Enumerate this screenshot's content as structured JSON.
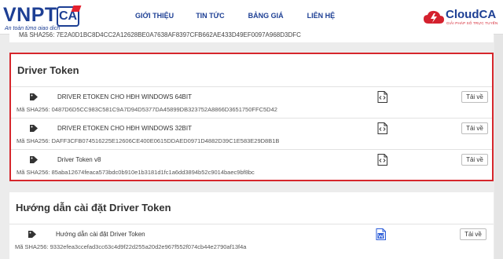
{
  "brand": {
    "logo_text": "VNPT",
    "logo_ca": "CA",
    "logo_tagline": "An toàn từng giao dịch",
    "cloud_name": "CloudCA",
    "cloud_tagline": "GIẢI PHÁP SỐ TRỰC TUYẾN"
  },
  "nav": {
    "items": [
      "GIỚI THIỆU",
      "TIN TỨC",
      "BẢNG GIÁ",
      "LIÊN HỆ"
    ]
  },
  "top_card": {
    "sha_label": "Mã SHA256:",
    "sha_value": "7E2A0D1BC8D4CC2A12628BE0A7638AF8397CFB662AE433D49EF0097A968D3DFC"
  },
  "sections": [
    {
      "title": "Driver Token",
      "items": [
        {
          "name": "DRIVER ETOKEN CHO HĐH WINDOWS 64BIT",
          "sha_label": "Mã SHA256:",
          "sha_value": "0487D6D5CC983C581C9A7D94D5377DA45899DB323752A8866D3651750FFC5D42",
          "file_type": "code",
          "download_label": "Tải về"
        },
        {
          "name": "DRIVER ETOKEN CHO HĐH WINDOWS 32BIT",
          "sha_label": "Mã SHA256:",
          "sha_value": "DAFF3CFB074516225E12606CE400E0615DDAED0971D4882D39C1E583E29D8B1B",
          "file_type": "code",
          "download_label": "Tải về"
        },
        {
          "name": "Driver Token v8",
          "sha_label": "Mã SHA256:",
          "sha_value": "85aba12674feaca573bdc0b910e1b3181d1fc1a6dd3894b52c9014baec9bf8bc",
          "file_type": "code",
          "download_label": "Tải về"
        }
      ]
    },
    {
      "title": "Hướng dẫn cài đặt Driver Token",
      "items": [
        {
          "name": "Hướng dẫn cài đặt Driver Token",
          "sha_label": "Mã SHA256:",
          "sha_value": "9332efea3ccefad3cc63c4d9f22d255a20d2e967f552f074cb44e2790af13f4a",
          "file_type": "word",
          "download_label": "Tải về"
        }
      ]
    }
  ],
  "colors": {
    "brand_blue": "#1d3f94",
    "brand_red": "#e4212f",
    "highlight_border": "#d6262c",
    "word_blue": "#2b5cd8"
  }
}
